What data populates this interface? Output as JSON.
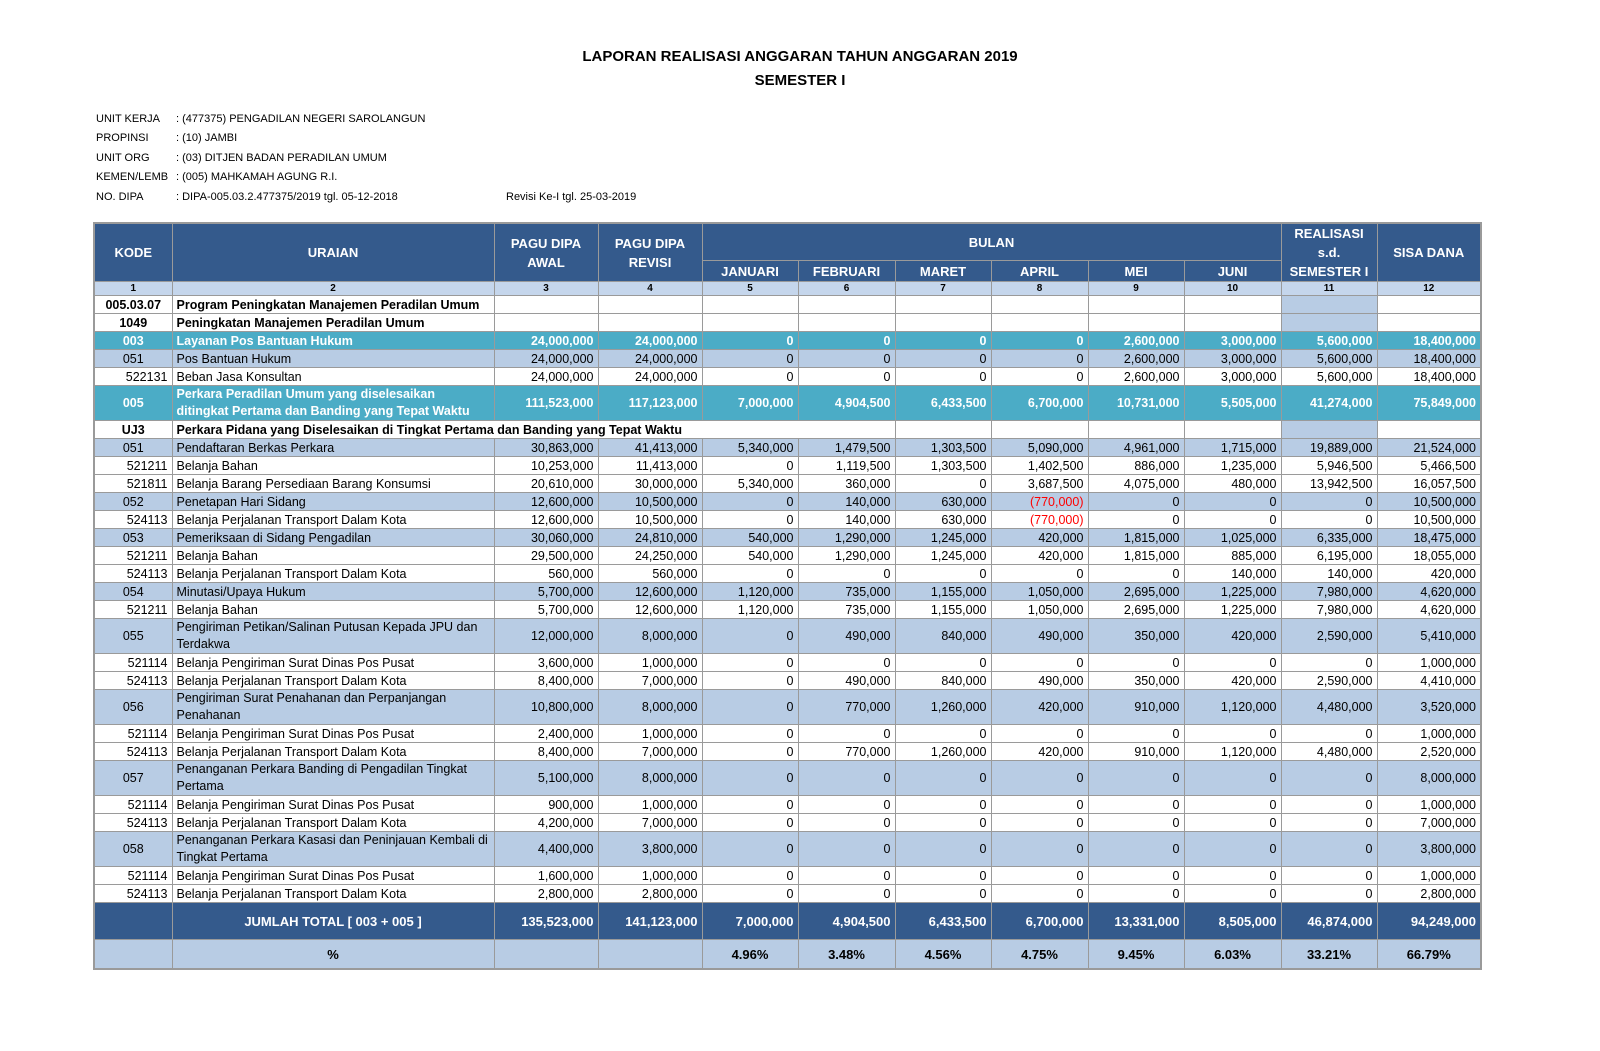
{
  "title": "LAPORAN REALISASI ANGGARAN TAHUN ANGGARAN 2019",
  "subtitle": "SEMESTER I",
  "meta": [
    {
      "key": "UNIT KERJA",
      "value": ": (477375) PENGADILAN NEGERI SAROLANGUN",
      "extra": ""
    },
    {
      "key": "PROPINSI",
      "value": ": (10) JAMBI",
      "extra": ""
    },
    {
      "key": "UNIT ORG",
      "value": ": (03) DITJEN BADAN PERADILAN UMUM",
      "extra": ""
    },
    {
      "key": "KEMEN/LEMB",
      "value": ": (005) MAHKAMAH AGUNG R.I.",
      "extra": ""
    },
    {
      "key": "NO. DIPA",
      "value": ": DIPA-005.03.2.477375/2019 tgl. 05-12-2018",
      "extra": "Revisi Ke-I tgl. 25-03-2019"
    }
  ],
  "headers": {
    "kode": "KODE",
    "uraian": "URAIAN",
    "pagu_awal": "PAGU DIPA AWAL",
    "pagu_revisi": "PAGU DIPA REVISI",
    "bulan": "BULAN",
    "months": [
      "JANUARI",
      "FEBRUARI",
      "MARET",
      "APRIL",
      "MEI",
      "JUNI"
    ],
    "realisasi": "REALISASI s.d. SEMESTER I",
    "sisa": "SISA DANA",
    "col_numbers": [
      "1",
      "2",
      "3",
      "4",
      "5",
      "6",
      "7",
      "8",
      "9",
      "10",
      "11",
      "12"
    ]
  },
  "rows": [
    {
      "style": "white bold",
      "kode": "005.03.07",
      "kalign": "c",
      "uraian": "Program Peningkatan Manajemen Peradilan Umum",
      "vals": [
        "",
        "",
        "",
        "",
        "",
        "",
        "",
        "",
        "",
        ""
      ]
    },
    {
      "style": "white bold",
      "kode": "1049",
      "kalign": "c",
      "uraian": "Peningkatan Manajemen Peradilan Umum",
      "vals": [
        "",
        "",
        "",
        "",
        "",
        "",
        "",
        "",
        "",
        ""
      ]
    },
    {
      "style": "teal",
      "kode": "003",
      "kalign": "c",
      "uraian": "Layanan Pos Bantuan Hukum",
      "vals": [
        "24,000,000",
        "24,000,000",
        "0",
        "0",
        "0",
        "0",
        "2,600,000",
        "3,000,000",
        "5,600,000",
        "18,400,000"
      ]
    },
    {
      "style": "blue",
      "kode": "051",
      "kalign": "c",
      "uraian": "Pos Bantuan Hukum",
      "vals": [
        "24,000,000",
        "24,000,000",
        "0",
        "0",
        "0",
        "0",
        "2,600,000",
        "3,000,000",
        "5,600,000",
        "18,400,000"
      ]
    },
    {
      "style": "white",
      "kode": "522131",
      "kalign": "r",
      "uraian": "Beban Jasa Konsultan",
      "vals": [
        "24,000,000",
        "24,000,000",
        "0",
        "0",
        "0",
        "0",
        "2,600,000",
        "3,000,000",
        "5,600,000",
        "18,400,000"
      ]
    },
    {
      "style": "teal tall",
      "kode": "005",
      "kalign": "c",
      "uraian": "Perkara Peradilan Umum yang diselesaikan ditingkat Pertama dan Banding yang Tepat Waktu",
      "vals": [
        "111,523,000",
        "117,123,000",
        "7,000,000",
        "4,904,500",
        "6,433,500",
        "6,700,000",
        "10,731,000",
        "5,505,000",
        "41,274,000",
        "75,849,000"
      ]
    },
    {
      "style": "white bold span",
      "kode": "UJ3",
      "kalign": "c",
      "uraian": "Perkara Pidana yang Diselesaikan di Tingkat Pertama dan Banding yang Tepat Waktu",
      "vals": [
        "",
        "",
        "",
        "",
        "",
        "",
        "",
        "",
        "",
        ""
      ]
    },
    {
      "style": "blue",
      "kode": "051",
      "kalign": "c",
      "uraian": "Pendaftaran Berkas Perkara",
      "vals": [
        "30,863,000",
        "41,413,000",
        "5,340,000",
        "1,479,500",
        "1,303,500",
        "5,090,000",
        "4,961,000",
        "1,715,000",
        "19,889,000",
        "21,524,000"
      ]
    },
    {
      "style": "white",
      "kode": "521211",
      "kalign": "r",
      "uraian": "Belanja Bahan",
      "vals": [
        "10,253,000",
        "11,413,000",
        "0",
        "1,119,500",
        "1,303,500",
        "1,402,500",
        "886,000",
        "1,235,000",
        "5,946,500",
        "5,466,500"
      ]
    },
    {
      "style": "white",
      "kode": "521811",
      "kalign": "r",
      "uraian": "Belanja Barang Persediaan Barang Konsumsi",
      "vals": [
        "20,610,000",
        "30,000,000",
        "5,340,000",
        "360,000",
        "0",
        "3,687,500",
        "4,075,000",
        "480,000",
        "13,942,500",
        "16,057,500"
      ]
    },
    {
      "style": "blue",
      "kode": "052",
      "kalign": "c",
      "uraian": "Penetapan Hari Sidang",
      "vals": [
        "12,600,000",
        "10,500,000",
        "0",
        "140,000",
        "630,000",
        "(770,000)",
        "0",
        "0",
        "0",
        "10,500,000"
      ]
    },
    {
      "style": "white",
      "kode": "524113",
      "kalign": "r",
      "uraian": "Belanja Perjalanan Transport Dalam Kota",
      "vals": [
        "12,600,000",
        "10,500,000",
        "0",
        "140,000",
        "630,000",
        "(770,000)",
        "0",
        "0",
        "0",
        "10,500,000"
      ]
    },
    {
      "style": "blue",
      "kode": "053",
      "kalign": "c",
      "uraian": "Pemeriksaan di Sidang Pengadilan",
      "vals": [
        "30,060,000",
        "24,810,000",
        "540,000",
        "1,290,000",
        "1,245,000",
        "420,000",
        "1,815,000",
        "1,025,000",
        "6,335,000",
        "18,475,000"
      ]
    },
    {
      "style": "white",
      "kode": "521211",
      "kalign": "r",
      "uraian": "Belanja Bahan",
      "vals": [
        "29,500,000",
        "24,250,000",
        "540,000",
        "1,290,000",
        "1,245,000",
        "420,000",
        "1,815,000",
        "885,000",
        "6,195,000",
        "18,055,000"
      ]
    },
    {
      "style": "white",
      "kode": "524113",
      "kalign": "r",
      "uraian": "Belanja Perjalanan Transport Dalam Kota",
      "vals": [
        "560,000",
        "560,000",
        "0",
        "0",
        "0",
        "0",
        "0",
        "140,000",
        "140,000",
        "420,000"
      ]
    },
    {
      "style": "blue",
      "kode": "054",
      "kalign": "c",
      "uraian": "Minutasi/Upaya Hukum",
      "vals": [
        "5,700,000",
        "12,600,000",
        "1,120,000",
        "735,000",
        "1,155,000",
        "1,050,000",
        "2,695,000",
        "1,225,000",
        "7,980,000",
        "4,620,000"
      ]
    },
    {
      "style": "white",
      "kode": "521211",
      "kalign": "r",
      "uraian": "Belanja Bahan",
      "vals": [
        "5,700,000",
        "12,600,000",
        "1,120,000",
        "735,000",
        "1,155,000",
        "1,050,000",
        "2,695,000",
        "1,225,000",
        "7,980,000",
        "4,620,000"
      ]
    },
    {
      "style": "blue tall",
      "kode": "055",
      "kalign": "c",
      "uraian": "Pengiriman Petikan/Salinan Putusan Kepada JPU dan Terdakwa",
      "vals": [
        "12,000,000",
        "8,000,000",
        "0",
        "490,000",
        "840,000",
        "490,000",
        "350,000",
        "420,000",
        "2,590,000",
        "5,410,000"
      ]
    },
    {
      "style": "white",
      "kode": "521114",
      "kalign": "r",
      "uraian": "Belanja Pengiriman Surat Dinas Pos Pusat",
      "vals": [
        "3,600,000",
        "1,000,000",
        "0",
        "0",
        "0",
        "0",
        "0",
        "0",
        "0",
        "1,000,000"
      ]
    },
    {
      "style": "white",
      "kode": "524113",
      "kalign": "r",
      "uraian": "Belanja Perjalanan Transport Dalam Kota",
      "vals": [
        "8,400,000",
        "7,000,000",
        "0",
        "490,000",
        "840,000",
        "490,000",
        "350,000",
        "420,000",
        "2,590,000",
        "4,410,000"
      ]
    },
    {
      "style": "blue tall",
      "kode": "056",
      "kalign": "c",
      "uraian": "Pengiriman Surat Penahanan dan Perpanjangan Penahanan",
      "vals": [
        "10,800,000",
        "8,000,000",
        "0",
        "770,000",
        "1,260,000",
        "420,000",
        "910,000",
        "1,120,000",
        "4,480,000",
        "3,520,000"
      ]
    },
    {
      "style": "white",
      "kode": "521114",
      "kalign": "r",
      "uraian": "Belanja Pengiriman Surat Dinas Pos Pusat",
      "vals": [
        "2,400,000",
        "1,000,000",
        "0",
        "0",
        "0",
        "0",
        "0",
        "0",
        "0",
        "1,000,000"
      ]
    },
    {
      "style": "white",
      "kode": "524113",
      "kalign": "r",
      "uraian": "Belanja Perjalanan Transport Dalam Kota",
      "vals": [
        "8,400,000",
        "7,000,000",
        "0",
        "770,000",
        "1,260,000",
        "420,000",
        "910,000",
        "1,120,000",
        "4,480,000",
        "2,520,000"
      ]
    },
    {
      "style": "blue tall",
      "kode": "057",
      "kalign": "c",
      "uraian": "Penanganan Perkara Banding di Pengadilan Tingkat Pertama",
      "vals": [
        "5,100,000",
        "8,000,000",
        "0",
        "0",
        "0",
        "0",
        "0",
        "0",
        "0",
        "8,000,000"
      ]
    },
    {
      "style": "white",
      "kode": "521114",
      "kalign": "r",
      "uraian": "Belanja Pengiriman Surat Dinas Pos Pusat",
      "vals": [
        "900,000",
        "1,000,000",
        "0",
        "0",
        "0",
        "0",
        "0",
        "0",
        "0",
        "1,000,000"
      ]
    },
    {
      "style": "white",
      "kode": "524113",
      "kalign": "r",
      "uraian": "Belanja Perjalanan Transport Dalam Kota",
      "vals": [
        "4,200,000",
        "7,000,000",
        "0",
        "0",
        "0",
        "0",
        "0",
        "0",
        "0",
        "7,000,000"
      ]
    },
    {
      "style": "blue tall",
      "kode": "058",
      "kalign": "c",
      "uraian": "Penanganan Perkara Kasasi dan Peninjauan Kembali di Tingkat Pertama",
      "vals": [
        "4,400,000",
        "3,800,000",
        "0",
        "0",
        "0",
        "0",
        "0",
        "0",
        "0",
        "3,800,000"
      ]
    },
    {
      "style": "white",
      "kode": "521114",
      "kalign": "r",
      "uraian": "Belanja Pengiriman Surat Dinas Pos Pusat",
      "vals": [
        "1,600,000",
        "1,000,000",
        "0",
        "0",
        "0",
        "0",
        "0",
        "0",
        "0",
        "1,000,000"
      ]
    },
    {
      "style": "white",
      "kode": "524113",
      "kalign": "r",
      "uraian": "Belanja Perjalanan Transport Dalam Kota",
      "vals": [
        "2,800,000",
        "2,800,000",
        "0",
        "0",
        "0",
        "0",
        "0",
        "0",
        "0",
        "2,800,000"
      ]
    }
  ],
  "total": {
    "label": "JUMLAH TOTAL [ 003 + 005 ]",
    "vals": [
      "135,523,000",
      "141,123,000",
      "7,000,000",
      "4,904,500",
      "6,433,500",
      "6,700,000",
      "13,331,000",
      "8,505,000",
      "46,874,000",
      "94,249,000"
    ]
  },
  "percent": {
    "label": "%",
    "vals": [
      "",
      "",
      "4.96%",
      "3.48%",
      "4.56%",
      "4.75%",
      "9.45%",
      "6.03%",
      "33.21%",
      "66.79%"
    ]
  },
  "colors": {
    "header_bg": "#345a8c",
    "teal": "#4bacc6",
    "light_blue": "#b8cce4",
    "negative": "#ff0000"
  }
}
